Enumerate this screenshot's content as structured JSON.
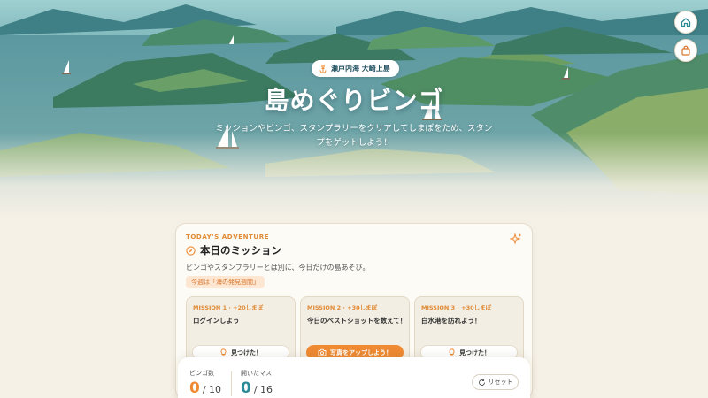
{
  "hero": {
    "location": "瀬戸内海 大崎上島",
    "title": "島めぐりビンゴ",
    "subtitle": "ミッションやビンゴ、スタンプラリーをクリアしてしまぽをため、スタンプをゲットしよう！"
  },
  "nav": {
    "home_icon": "home-icon",
    "bag_icon": "shopping-bag-icon"
  },
  "mission_card": {
    "eyebrow": "TODAY'S ADVENTURE",
    "title": "本日のミッション",
    "description": "ビンゴやスタンプラリーとは別に、今日だけの島あそび。",
    "week_tag": "今週は「海の発見週間」",
    "missions": [
      {
        "label": "MISSION 1 · +20しまぽ",
        "text": "ログインしよう",
        "button": "見つけた！",
        "button_icon": "lightbulb-icon"
      },
      {
        "label": "MISSION 2 · +30しまぽ",
        "text": "今日のベストショットを数えて！",
        "button": "写真をアップしよう！",
        "button_icon": "camera-icon"
      },
      {
        "label": "MISSION 3 · +30しまぽ",
        "text": "白水港を訪れよう！",
        "button": "見つけた！",
        "button_icon": "lightbulb-icon"
      }
    ]
  },
  "bingo": {
    "bingo_label": "ビンゴ数",
    "bingo_value": "0",
    "bingo_total": "/ 10",
    "open_label": "開いたマス",
    "open_value": "0",
    "open_total": "/ 16",
    "reset_label": "リセット"
  },
  "colors": {
    "accent_orange": "#ef8a33",
    "accent_teal": "#2a8a96",
    "background": "#f6f1e7"
  }
}
